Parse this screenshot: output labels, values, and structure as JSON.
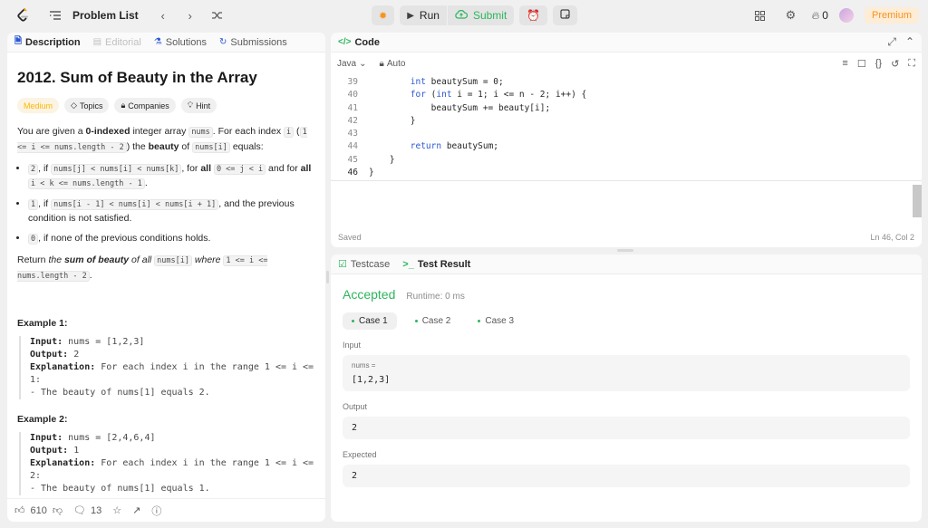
{
  "topbar": {
    "problem_list_label": "Problem List",
    "run_label": "Run",
    "submit_label": "Submit",
    "streak_count": "0",
    "premium_label": "Premium"
  },
  "left": {
    "tabs": {
      "description": "Description",
      "editorial": "Editorial",
      "solutions": "Solutions",
      "submissions": "Submissions"
    },
    "title": "2012. Sum of Beauty in the Array",
    "chips": {
      "difficulty": "Medium",
      "topics": "Topics",
      "companies": "Companies",
      "hint": "Hint"
    },
    "intro": {
      "t1": "You are given a ",
      "bold1": "0-indexed",
      "t2": " integer array ",
      "c1": "nums",
      "t3": ". For each index ",
      "c2": "i",
      "t4": " (",
      "c3": "1 <= i <= nums.length - 2",
      "t5": ") the ",
      "bold2": "beauty",
      "t6": " of ",
      "c4": "nums[i]",
      "t7": " equals:"
    },
    "bullet1": {
      "c1": "2",
      "t1": ", if ",
      "c2": "nums[j] < nums[i] < nums[k]",
      "t2": ", for ",
      "b1": "all",
      "c3": "0 <= j < i",
      "t3": " and for ",
      "b2": "all",
      "c4": "i < k <= nums.length - 1",
      "t4": "."
    },
    "bullet2": {
      "c1": "1",
      "t1": ", if ",
      "c2": "nums[i - 1] < nums[i] < nums[i + 1]",
      "t2": ", and the previous condition is not satisfied."
    },
    "bullet3": {
      "c1": "0",
      "t1": ", if none of the previous conditions holds."
    },
    "return_text": {
      "t1": "Return ",
      "t2": "the ",
      "bold": "sum of beauty",
      "t3": " of all ",
      "c1": "nums[i]",
      "t4": " where ",
      "c2": "1 <= i <= nums.length - 2",
      "t5": "."
    },
    "example1": {
      "title": "Example 1:",
      "input_label": "Input:",
      "input": "nums = [1,2,3]",
      "output_label": "Output:",
      "output": "2",
      "explanation_label": "Explanation:",
      "explanation": "For each index i in the range 1 <= i <= 1:",
      "line": "- The beauty of nums[1] equals 2."
    },
    "example2": {
      "title": "Example 2:",
      "input_label": "Input:",
      "input": "nums = [2,4,6,4]",
      "output_label": "Output:",
      "output": "1",
      "explanation_label": "Explanation:",
      "explanation": "For each index i in the range 1 <= i <= 2:",
      "line": "- The beauty of nums[1] equals 1."
    },
    "footer": {
      "likes": "610",
      "comments": "13"
    }
  },
  "code": {
    "tab_label": "Code",
    "language": "Java",
    "mode": "Auto",
    "lines": [
      {
        "num": "39",
        "indent": "        ",
        "kw": "int",
        "rest": " beautySum = 0;"
      },
      {
        "num": "40",
        "indent": "        ",
        "kw": "for",
        "rest": " (",
        "kw2": "int",
        "rest2": " i = 1; i <= n - 2; i++) {"
      },
      {
        "num": "41",
        "indent": "            ",
        "kw": "",
        "rest": "beautySum += beauty[i];"
      },
      {
        "num": "42",
        "indent": "        ",
        "kw": "",
        "rest": "}"
      },
      {
        "num": "43",
        "indent": "",
        "kw": "",
        "rest": ""
      },
      {
        "num": "44",
        "indent": "        ",
        "kw": "return",
        "rest": " beautySum;"
      },
      {
        "num": "45",
        "indent": "    ",
        "kw": "",
        "rest": "}"
      },
      {
        "num": "46",
        "indent": "",
        "kw": "",
        "rest": "}"
      }
    ],
    "status_saved": "Saved",
    "cursor_pos": "Ln 46, Col 2"
  },
  "result": {
    "tabs": {
      "testcase": "Testcase",
      "test_result": "Test Result"
    },
    "status": "Accepted",
    "runtime": "Runtime: 0 ms",
    "cases": [
      "Case 1",
      "Case 2",
      "Case 3"
    ],
    "input_label": "Input",
    "input_var": "nums =",
    "input_value": "[1,2,3]",
    "output_label": "Output",
    "output_value": "2",
    "expected_label": "Expected",
    "expected_value": "2"
  }
}
